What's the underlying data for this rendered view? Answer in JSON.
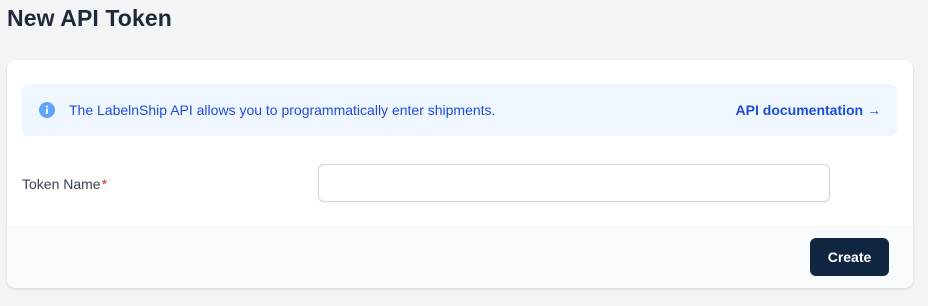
{
  "page": {
    "title": "New API Token"
  },
  "info_banner": {
    "icon": "info-circle-icon",
    "message": "The LabelnShip API allows you to programmatically enter shipments.",
    "link_label": "API documentation →",
    "color_text": "#1d4ed8",
    "color_bg": "#eff6ff"
  },
  "form": {
    "token_name": {
      "label": "Token Name",
      "required_marker": "*",
      "value": "",
      "placeholder": ""
    }
  },
  "footer": {
    "create_label": "Create",
    "button_color": "#0f2540"
  }
}
